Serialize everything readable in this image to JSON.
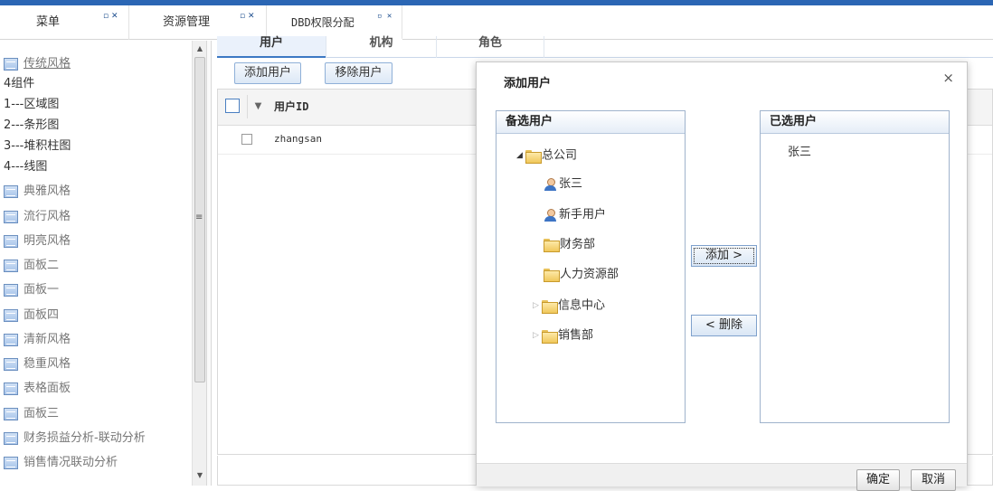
{
  "tabs": [
    {
      "label": "菜单"
    },
    {
      "label": "资源管理"
    },
    {
      "label": "DBD权限分配"
    }
  ],
  "tab_buttons": {
    "restore": "▫",
    "close": "✕"
  },
  "menu": {
    "items": [
      {
        "label": "传统风格",
        "icon": "panel-icon"
      },
      {
        "label": "4组件",
        "icon": ""
      },
      {
        "label": "1---区域图",
        "icon": ""
      },
      {
        "label": "2---条形图",
        "icon": ""
      },
      {
        "label": "3---堆积柱图",
        "icon": ""
      },
      {
        "label": "4---线图",
        "icon": ""
      },
      {
        "label": "典雅风格",
        "icon": "panel-icon"
      },
      {
        "label": "流行风格",
        "icon": "panel-icon"
      },
      {
        "label": "明亮风格",
        "icon": "panel-icon"
      },
      {
        "label": "面板二",
        "icon": "panel-icon"
      },
      {
        "label": "面板一",
        "icon": "panel-icon"
      },
      {
        "label": "面板四",
        "icon": "panel-icon"
      },
      {
        "label": "清新风格",
        "icon": "panel-icon"
      },
      {
        "label": "稳重风格",
        "icon": "panel-icon"
      },
      {
        "label": "表格面板",
        "icon": "panel-icon"
      },
      {
        "label": "面板三",
        "icon": "panel-icon"
      },
      {
        "label": "财务损益分析-联动分析",
        "icon": "panel-icon"
      },
      {
        "label": "销售情况联动分析",
        "icon": "panel-icon"
      }
    ]
  },
  "subtabs": [
    {
      "label": "用户"
    },
    {
      "label": "机构"
    },
    {
      "label": "角色"
    }
  ],
  "toolbar": {
    "add_user": "添加用户",
    "remove_user": "移除用户"
  },
  "grid": {
    "column_header": "用户ID",
    "rows": [
      {
        "user_id": "zhangsan"
      }
    ]
  },
  "dialog": {
    "title": "添加用户",
    "close": "×",
    "available_title": "备选用户",
    "selected_title": "已选用户",
    "tree": {
      "root": "总公司",
      "children": [
        {
          "label": "张三",
          "type": "user"
        },
        {
          "label": "新手用户",
          "type": "user"
        },
        {
          "label": "财务部",
          "type": "folder"
        },
        {
          "label": "人力资源部",
          "type": "folder"
        },
        {
          "label": "信息中心",
          "type": "folder"
        },
        {
          "label": "销售部",
          "type": "folder"
        }
      ]
    },
    "selected": [
      "张三"
    ],
    "add_button": "添加 >",
    "remove_button": "< 删除",
    "ok_button": "确定",
    "cancel_button": "取消"
  }
}
